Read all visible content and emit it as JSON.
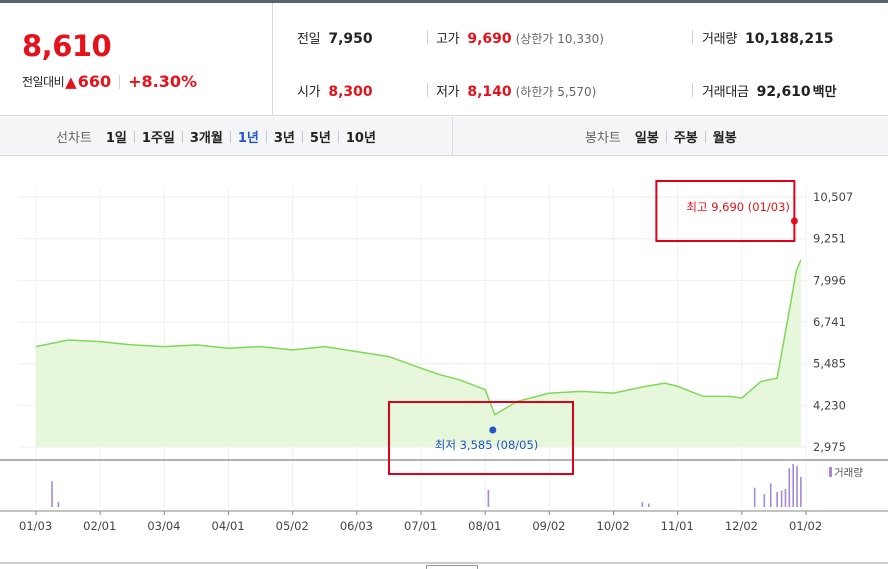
{
  "summary": {
    "current_price": "8,610",
    "change_label": "전일대비",
    "change_amount": "660",
    "change_percent": "+8.30%",
    "stats": {
      "prev_close": {
        "label": "전일",
        "value": "7,950"
      },
      "high": {
        "label": "고가",
        "value": "9,690",
        "sub": "(상한가 10,330)"
      },
      "volume": {
        "label": "거래량",
        "value": "10,188,215"
      },
      "open": {
        "label": "시가",
        "value": "8,300"
      },
      "low": {
        "label": "저가",
        "value": "8,140",
        "sub": "(하한가 5,570)"
      },
      "amount": {
        "label": "거래대금",
        "value": "92,610",
        "unit": "백만"
      }
    }
  },
  "toolbar": {
    "line_chart_title": "선차트",
    "periods": [
      "1일",
      "1주일",
      "3개월",
      "1년",
      "3년",
      "5년",
      "10년"
    ],
    "active_period": "1년",
    "candle_chart_title": "봉차트",
    "candles": [
      "일봉",
      "주봉",
      "월봉"
    ]
  },
  "colors": {
    "up": "#e5121b",
    "down": "#2456c8",
    "line": "#7ed957",
    "area": "#e6f7dc",
    "volume": "#a48ad6",
    "highlight_box": "#e0001b"
  },
  "chart_data": {
    "type": "area",
    "x_tick_labels": [
      "01/03",
      "02/01",
      "03/04",
      "04/01",
      "05/02",
      "06/03",
      "07/01",
      "08/01",
      "09/02",
      "10/02",
      "11/01",
      "12/02",
      "01/02"
    ],
    "y_tick_labels": [
      "10,507",
      "9,251",
      "7,996",
      "6,741",
      "5,485",
      "4,230",
      "2,975"
    ],
    "ylim": [
      2975,
      10507
    ],
    "series": [
      {
        "x": [
          0,
          0.5,
          1,
          1.5,
          2,
          2.5,
          3,
          3.5,
          4,
          4.5,
          5,
          5.5,
          6,
          6.3,
          6.6,
          7,
          7.15,
          7.5,
          8,
          8.5,
          9,
          9.5,
          9.8,
          10,
          10.4,
          10.8,
          11,
          11.3,
          11.55,
          11.75,
          11.85,
          11.92
        ],
        "values": [
          6000,
          6200,
          6150,
          6050,
          6000,
          6050,
          5950,
          6000,
          5900,
          6000,
          5850,
          5700,
          5350,
          5150,
          5000,
          4700,
          3950,
          4350,
          4600,
          4650,
          4600,
          4800,
          4900,
          4800,
          4500,
          4500,
          4450,
          4950,
          5050,
          7200,
          8300,
          8610
        ]
      }
    ],
    "annotations": {
      "high": {
        "label": "최고",
        "value": "9,690",
        "date": "(01/03)",
        "x": 11.85,
        "y": 9690
      },
      "low": {
        "label": "최저",
        "value": "3,585",
        "date": "(08/05)",
        "x": 7.15,
        "y": 3585
      }
    },
    "volume": {
      "label": "거래량",
      "bars": [
        {
          "x": 0.25,
          "v": 0.6
        },
        {
          "x": 0.35,
          "v": 0.12
        },
        {
          "x": 7.05,
          "v": 0.4
        },
        {
          "x": 9.45,
          "v": 0.12
        },
        {
          "x": 9.55,
          "v": 0.08
        },
        {
          "x": 11.2,
          "v": 0.45
        },
        {
          "x": 11.35,
          "v": 0.3
        },
        {
          "x": 11.45,
          "v": 0.55
        },
        {
          "x": 11.55,
          "v": 0.35
        },
        {
          "x": 11.62,
          "v": 0.38
        },
        {
          "x": 11.68,
          "v": 0.42
        },
        {
          "x": 11.74,
          "v": 0.9
        },
        {
          "x": 11.8,
          "v": 1.0
        },
        {
          "x": 11.86,
          "v": 0.95
        },
        {
          "x": 11.92,
          "v": 0.7
        }
      ]
    }
  }
}
